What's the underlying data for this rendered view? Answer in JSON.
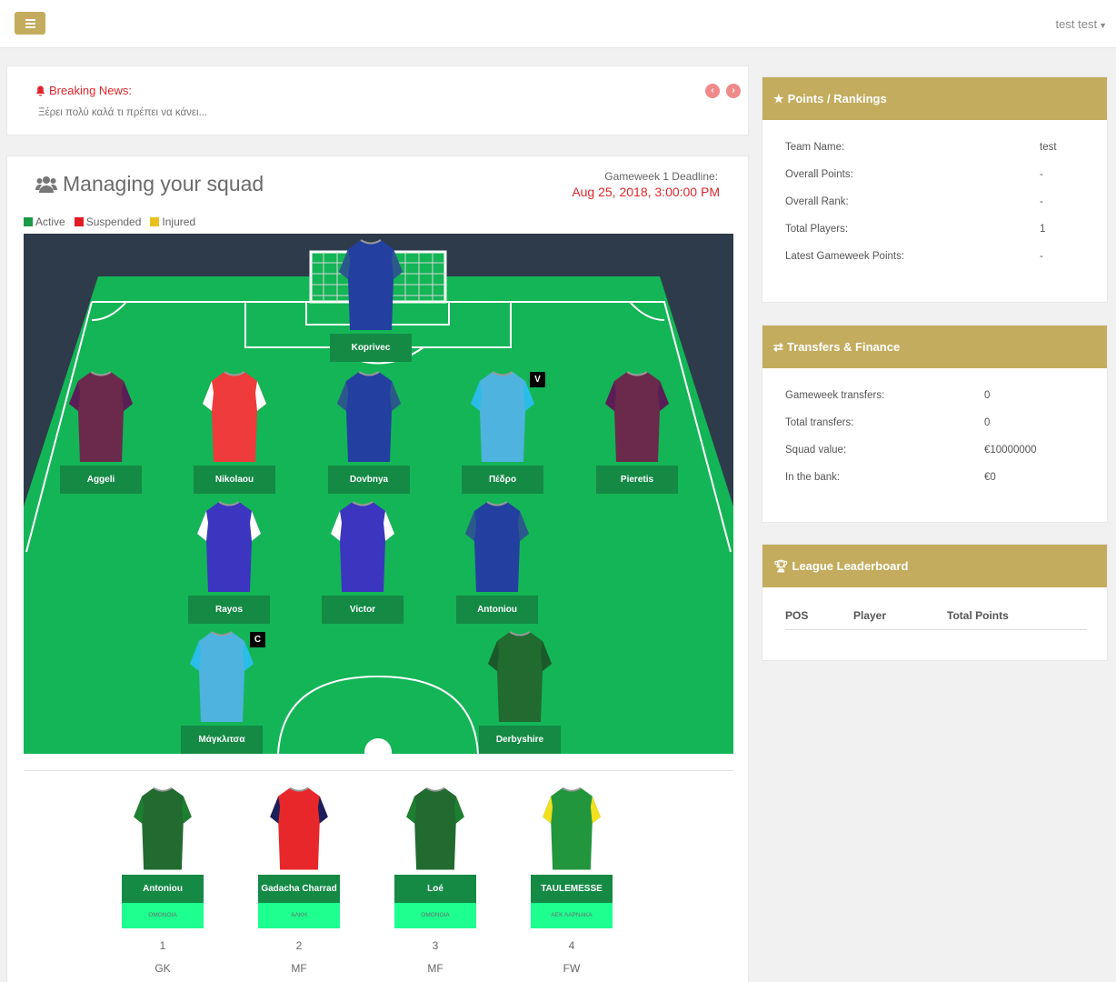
{
  "topbar": {
    "user": "test test"
  },
  "news": {
    "title": "Breaking News:",
    "text": "Ξέρει πολύ καλά τι πρέπει να κάνει..."
  },
  "squad": {
    "title": "Managing your squad",
    "deadline_label": "Gameweek 1 Deadline:",
    "deadline_date": "Aug 25, 2018, 3:00:00 PM",
    "legend": [
      {
        "label": "Active",
        "color": "#1a9946"
      },
      {
        "label": "Suspended",
        "color": "#e31b23"
      },
      {
        "label": "Injured",
        "color": "#e8c21a"
      }
    ],
    "players": [
      {
        "name": "Koprivec",
        "body": "#2340a0",
        "sleeve": "#2b5a8a"
      },
      {
        "name": "Aggeli",
        "body": "#6b2a4c",
        "sleeve": "#5a1e56"
      },
      {
        "name": "Nikolaou",
        "body": "#ef3b3b",
        "sleeve": "#ffffff"
      },
      {
        "name": "Dovbnya",
        "body": "#2340a0",
        "sleeve": "#2b5a8a"
      },
      {
        "name": "Πέδρο",
        "body": "#4fb3e0",
        "sleeve": "#29bde8",
        "badge": "V"
      },
      {
        "name": "Pieretis",
        "body": "#6b2a4c",
        "sleeve": "#5a1e56"
      },
      {
        "name": "Rayos",
        "body": "#3c35c0",
        "sleeve": "#ffffff"
      },
      {
        "name": "Victor",
        "body": "#3c35c0",
        "sleeve": "#ffffff"
      },
      {
        "name": "Antoniou",
        "body": "#2340a0",
        "sleeve": "#2b5a8a"
      },
      {
        "name": "Μάγκλιτσα",
        "body": "#4fb3e0",
        "sleeve": "#29bde8",
        "badge": "C"
      },
      {
        "name": "Derbyshire",
        "body": "#216a30",
        "sleeve": "#1a5a2a"
      }
    ],
    "bench": [
      {
        "name": "Antoniou",
        "team": "ΟΜΟΝΟΙΑ",
        "num": "1",
        "pos": "GK",
        "body": "#216a30",
        "sleeve": "#1d7f30"
      },
      {
        "name": "Gadacha Charrad",
        "team": "ΑΛΚΗ",
        "num": "2",
        "pos": "MF",
        "body": "#e8272a",
        "sleeve": "#1b1f5a"
      },
      {
        "name": "Loé",
        "team": "ΟΜΟΝΟΙΑ",
        "num": "3",
        "pos": "MF",
        "body": "#216a30",
        "sleeve": "#1d7f30"
      },
      {
        "name": "TAULEMESSE",
        "team": "ΑΕΚ ΛΑΡΝΑΚΑ",
        "num": "4",
        "pos": "FW",
        "body": "#22963c",
        "sleeve": "#f2e01f"
      }
    ]
  },
  "points": {
    "title": "Points / Rankings",
    "rows": [
      {
        "k": "Team Name:",
        "v": "test"
      },
      {
        "k": "Overall Points:",
        "v": "-"
      },
      {
        "k": "Overall Rank:",
        "v": "-"
      },
      {
        "k": "Total Players:",
        "v": "1"
      },
      {
        "k": "Latest Gameweek Points:",
        "v": "-"
      }
    ]
  },
  "transfers": {
    "title": "Transfers & Finance",
    "rows": [
      {
        "k": "Gameweek transfers:",
        "v": "0"
      },
      {
        "k": "Total transfers:",
        "v": "0"
      },
      {
        "k": "Squad value:",
        "v": "€10000000"
      },
      {
        "k": "In the bank:",
        "v": "€0"
      }
    ]
  },
  "league": {
    "title": "League Leaderboard",
    "col_pos": "POS",
    "col_player": "Player",
    "col_points": "Total Points"
  }
}
